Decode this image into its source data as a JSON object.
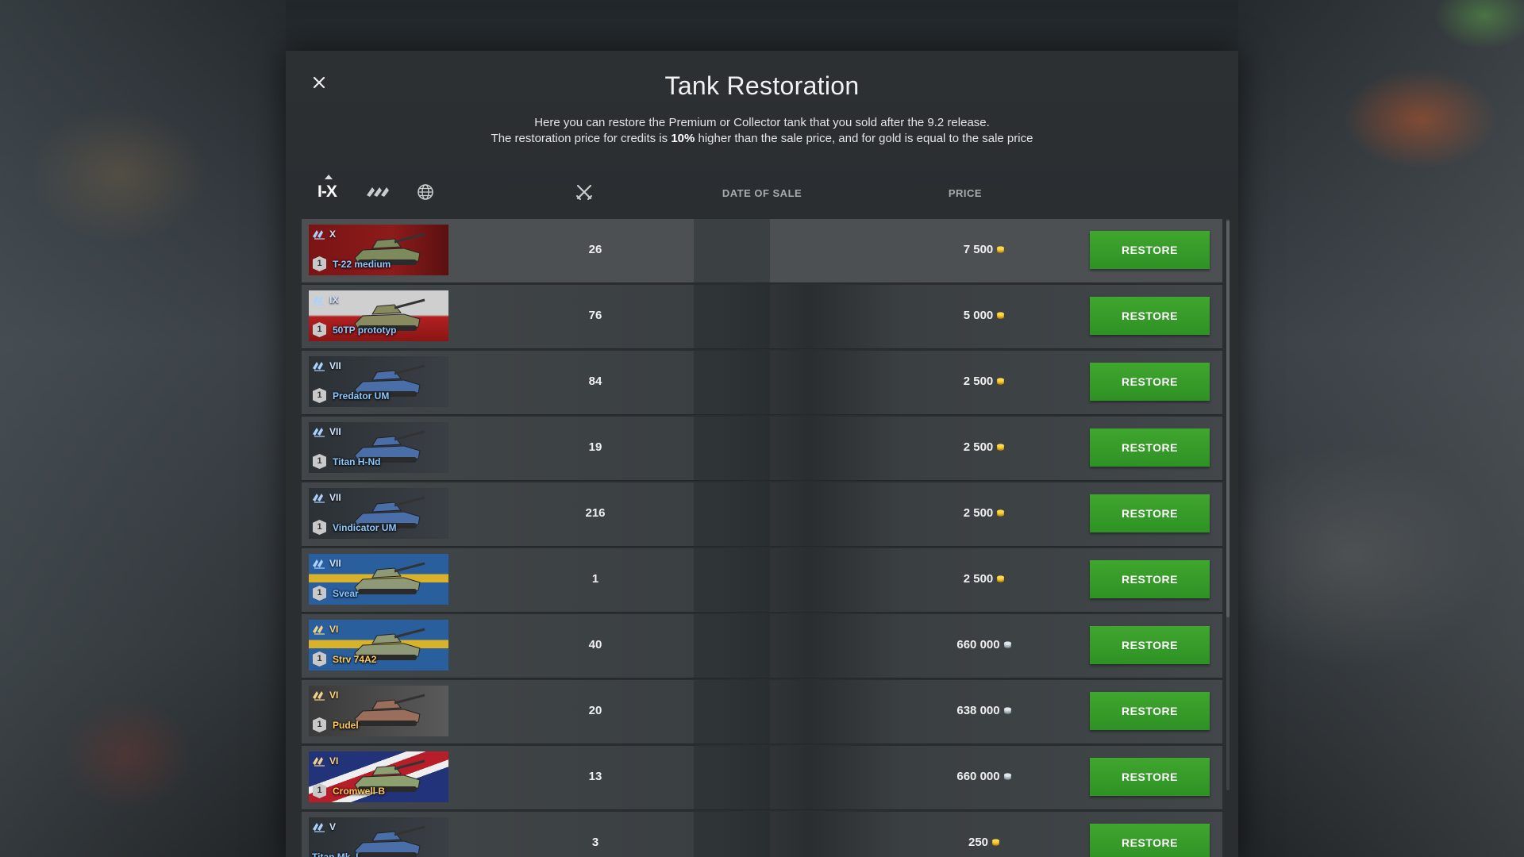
{
  "dialog": {
    "title": "Tank Restoration",
    "desc_line1": "Here you can restore the Premium or Collector tank that you sold after the 9.2 release.",
    "desc_line2_a": "The restoration price for credits is ",
    "desc_line2_bold": "10%",
    "desc_line2_b": " higher than the sale price, and for gold is equal to the sale price",
    "close_icon": "close-icon"
  },
  "header": {
    "sort_tier_label": "I-X",
    "sort_type_icon": "tank-type-icon",
    "sort_nation_icon": "globe-icon",
    "battles_icon": "crossed-swords-icon",
    "date_label": "DATE OF SALE",
    "price_label": "PRICE"
  },
  "colors": {
    "accent_green": "#3fa62e",
    "gold": "#f4c21b",
    "silver": "#c8d4dc",
    "premium_name": "#8cc8ff",
    "collector_name": "#ffcb55"
  },
  "restore_label": "RESTORE",
  "tanks": [
    {
      "tier": "X",
      "name": "T-22 medium",
      "count": "1",
      "battles": "26",
      "price": "7 500",
      "currency": "gold",
      "nation": "ussr",
      "kind": "premium"
    },
    {
      "tier": "IX",
      "name": "50TP prototyp",
      "count": "1",
      "battles": "76",
      "price": "5 000",
      "currency": "gold",
      "nation": "poland",
      "kind": "premium"
    },
    {
      "tier": "VII",
      "name": "Predator UM",
      "count": "1",
      "battles": "84",
      "price": "2 500",
      "currency": "gold",
      "nation": "europe",
      "kind": "premium"
    },
    {
      "tier": "VII",
      "name": "Titan H-Nd",
      "count": "1",
      "battles": "19",
      "price": "2 500",
      "currency": "gold",
      "nation": "europe",
      "kind": "premium"
    },
    {
      "tier": "VII",
      "name": "Vindicator UM",
      "count": "1",
      "battles": "216",
      "price": "2 500",
      "currency": "gold",
      "nation": "europe",
      "kind": "premium"
    },
    {
      "tier": "VII",
      "name": "Svear",
      "count": "1",
      "battles": "1",
      "price": "2 500",
      "currency": "gold",
      "nation": "sweden",
      "kind": "premium"
    },
    {
      "tier": "VI",
      "name": "Strv 74A2",
      "count": "1",
      "battles": "40",
      "price": "660 000",
      "currency": "credits",
      "nation": "sweden",
      "kind": "collector"
    },
    {
      "tier": "VI",
      "name": "Pudel",
      "count": "1",
      "battles": "20",
      "price": "638 000",
      "currency": "credits",
      "nation": "germany",
      "kind": "collector"
    },
    {
      "tier": "VI",
      "name": "Cromwell B",
      "count": "1",
      "battles": "13",
      "price": "660 000",
      "currency": "credits",
      "nation": "uk",
      "kind": "collector"
    },
    {
      "tier": "V",
      "name": "Titan Mk. I",
      "count": "",
      "battles": "3",
      "price": "250",
      "currency": "gold",
      "nation": "europe",
      "kind": "premium"
    }
  ]
}
